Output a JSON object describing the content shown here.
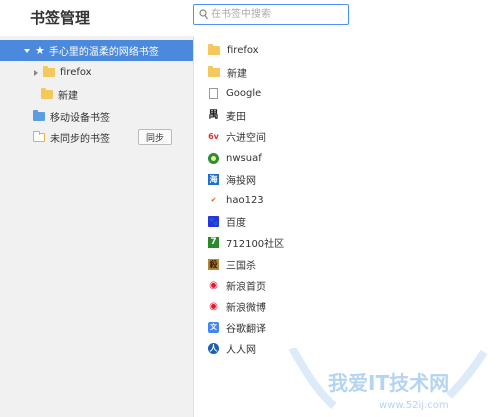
{
  "header": {
    "title": "书签管理",
    "search_placeholder": "在书签中搜索"
  },
  "sidebar": {
    "items": [
      {
        "label": "手心里的温柔的网络书签",
        "selected": true,
        "expanded": true
      },
      {
        "label": "firefox",
        "collapsed": true
      },
      {
        "label": "新建"
      },
      {
        "label": "移动设备书签"
      },
      {
        "label": "未同步的书签",
        "button": "同步"
      }
    ]
  },
  "main": {
    "items": [
      {
        "label": "firefox",
        "icon": "folder-icon"
      },
      {
        "label": "新建",
        "icon": "folder-icon"
      },
      {
        "label": "Google",
        "icon": "page-icon"
      },
      {
        "label": "麦田",
        "icon": "maitian-icon"
      },
      {
        "label": "六进空间",
        "icon": "liujin-icon"
      },
      {
        "label": "nwsuaf",
        "icon": "nwsuaf-icon"
      },
      {
        "label": "海投网",
        "icon": "haitou-icon"
      },
      {
        "label": "hao123",
        "icon": "hao123-icon"
      },
      {
        "label": "百度",
        "icon": "baidu-icon"
      },
      {
        "label": "712100社区",
        "icon": "712100-icon"
      },
      {
        "label": "三国杀",
        "icon": "sanguosha-icon"
      },
      {
        "label": "新浪首页",
        "icon": "weibo-icon"
      },
      {
        "label": "新浪微博",
        "icon": "weibo-icon"
      },
      {
        "label": "谷歌翻译",
        "icon": "translate-icon"
      },
      {
        "label": "人人网",
        "icon": "renren-icon"
      }
    ]
  },
  "watermark": {
    "text": "我爱IT技术网",
    "url": "www.52ij.com"
  },
  "colors": {
    "accent": "#4a89dc",
    "sidebar_bg": "#f1f1f1",
    "folder": "#f5c85c"
  }
}
